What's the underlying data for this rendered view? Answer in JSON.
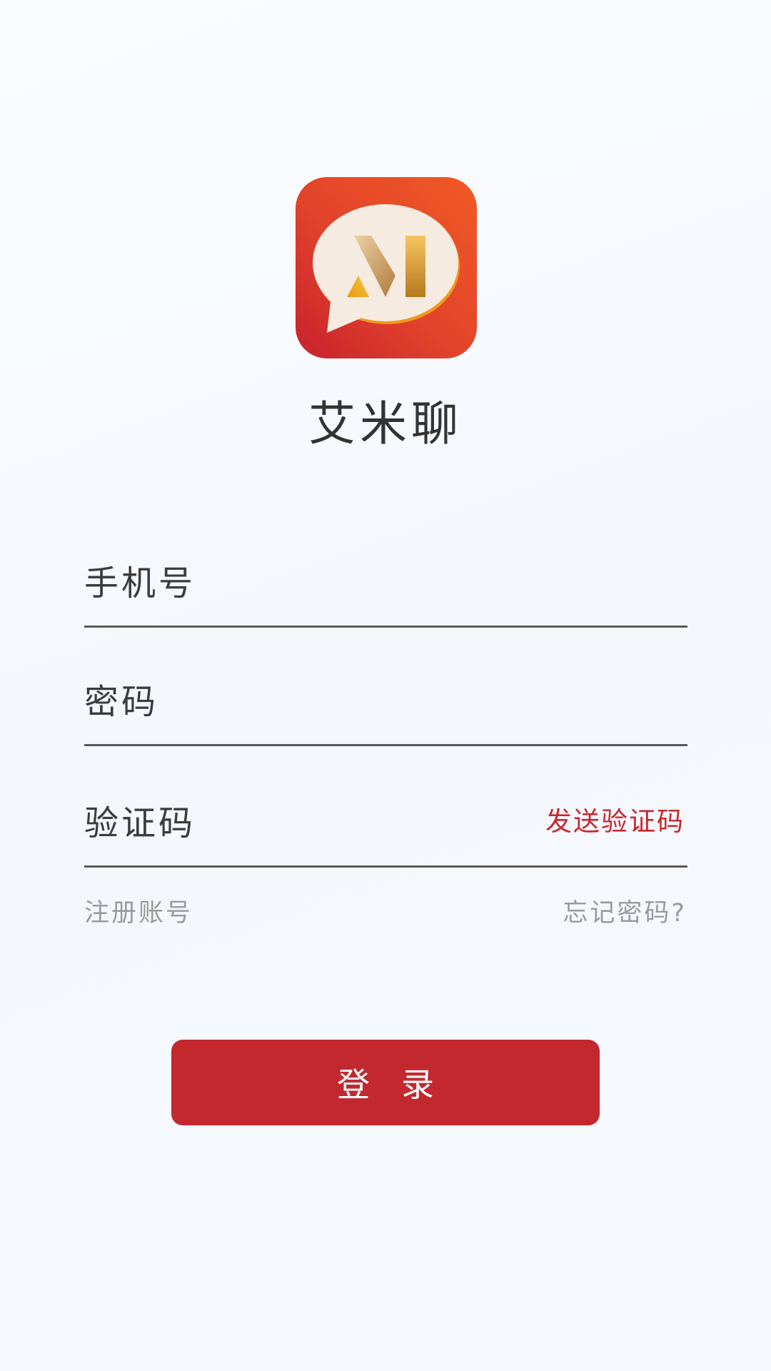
{
  "app": {
    "name": "艾米聊"
  },
  "logo": {
    "icon": "chat-bubble-logo-icon",
    "colors": {
      "background_start": "#c8222e",
      "background_end": "#f05a25",
      "bubble": "#f5ebe0",
      "bubble_shadow": "#f0991c",
      "mark_gold": "#e2a448"
    }
  },
  "form": {
    "phone_placeholder": "手机号",
    "password_placeholder": "密码",
    "code_placeholder": "验证码",
    "send_code_label": "发送验证码"
  },
  "links": {
    "register": "注册账号",
    "forgot_password": "忘记密码?"
  },
  "login_button": {
    "label": "登录"
  },
  "theme": {
    "accent": "#c3282f",
    "text": "#333333",
    "muted": "#9a9a9a",
    "underline": "#5a5a5a"
  }
}
